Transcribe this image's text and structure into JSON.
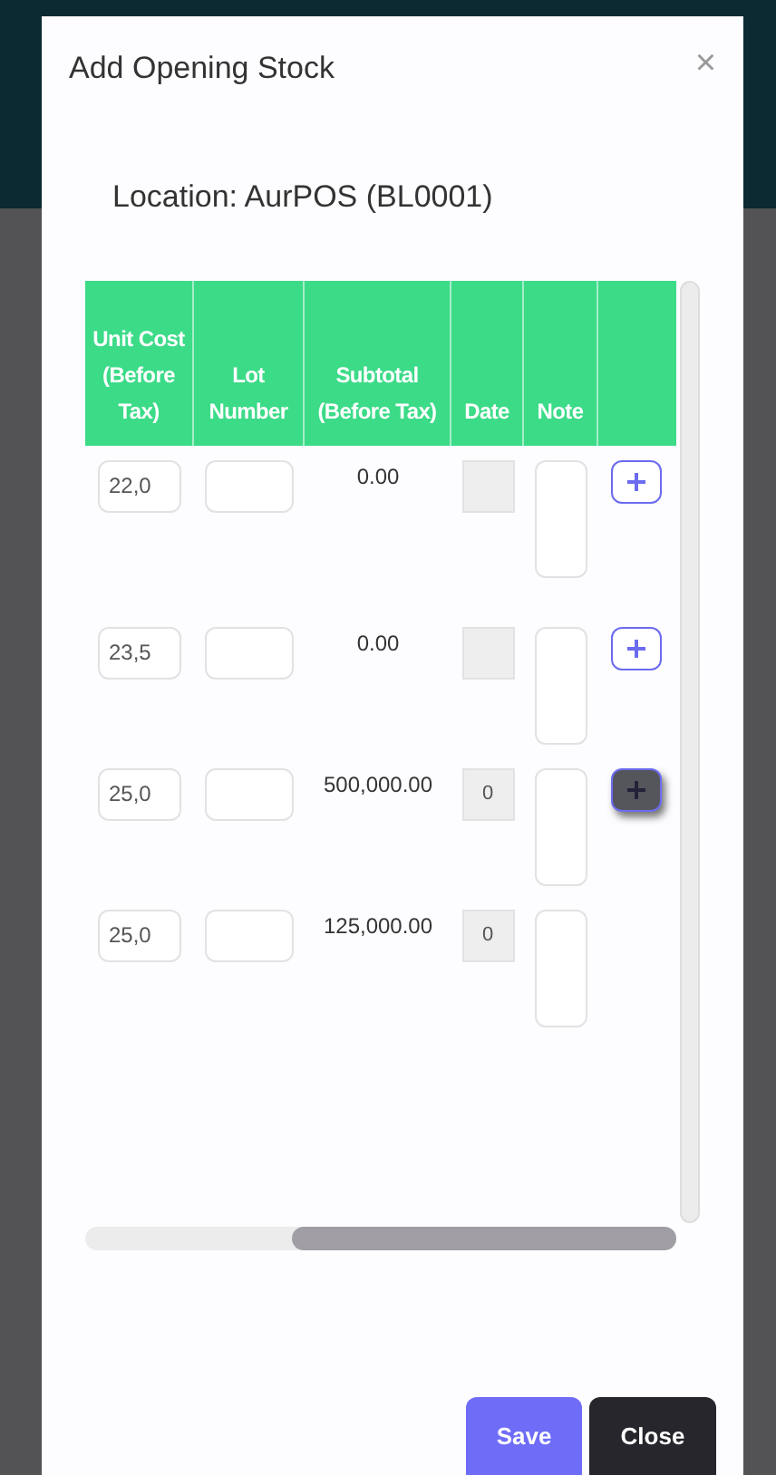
{
  "modal": {
    "title": "Add Opening Stock",
    "close_symbol": "×",
    "location": "Location: AurPOS (BL0001)"
  },
  "table": {
    "columns": [
      "Unit Cost (Before Tax)",
      "Lot Number",
      "Subtotal (Before Tax)",
      "Date",
      "Note"
    ],
    "rows": [
      {
        "unit_cost": "22,0",
        "subtotal": "0.00",
        "date": "",
        "kind": "add"
      },
      {
        "unit_cost": "23,5",
        "subtotal": "0.00",
        "date": "",
        "kind": "add"
      },
      {
        "unit_cost": "25,0",
        "subtotal": "500,000.00",
        "date": "0",
        "kind": "add-pressed"
      },
      {
        "unit_cost": "25,0",
        "subtotal": "125,000.00",
        "date": "0",
        "kind": "plain"
      }
    ]
  },
  "buttons": [
    {
      "label": "Save",
      "kind": "primary"
    },
    {
      "label": "Close",
      "kind": "dark"
    }
  ]
}
